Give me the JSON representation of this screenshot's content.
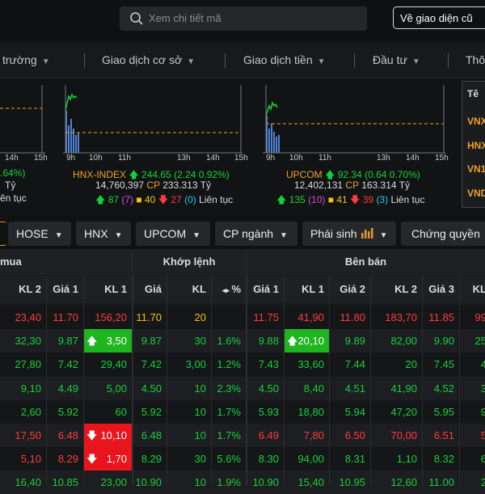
{
  "topbar": {
    "search_placeholder": "Xem chi tiết mã",
    "old_ui_label": "Về giao diện cũ"
  },
  "menu": [
    "ị trường",
    "Giao dịch cơ sở",
    "Giao dịch tiền",
    "Đầu tư",
    "Thô"
  ],
  "indices": [
    {
      "name": "",
      "value_text": ".64%)",
      "cp_text": "Tỷ",
      "status_text": "ên tục",
      "time_labels": [
        "14h",
        "15h"
      ]
    },
    {
      "name": "HNX-INDEX",
      "value": "244.65",
      "change": "(2.24 0.92%)",
      "volume": "14,760,397",
      "cp_label": "CP",
      "cp_value": "233.313",
      "unit": "Tỷ",
      "up": "87",
      "ref": "(7)",
      "flat": "40",
      "down": "27",
      "ceil": "(0)",
      "status": "Liên tục",
      "time_labels": [
        "9h",
        "10h",
        "11h",
        "13h",
        "14h",
        "15h"
      ]
    },
    {
      "name": "UPCOM",
      "value": "92.34",
      "change": "(0.64 0.70%)",
      "volume": "12,402,131",
      "cp_label": "CP",
      "cp_value": "163.314",
      "unit": "Tỷ",
      "up": "135",
      "ref": "(10)",
      "flat": "41",
      "down": "39",
      "ceil": "(3)",
      "status": "Liên tục",
      "time_labels": [
        "9h",
        "10h",
        "11h",
        "13h",
        "14h",
        "15h"
      ]
    }
  ],
  "right_panel": {
    "header": "Tê",
    "items": [
      "VNX",
      "HNX",
      "VN1",
      "VND"
    ]
  },
  "tabs": [
    "HOSE",
    "HNX",
    "UPCOM",
    "CP ngành",
    "Phái sinh",
    "Chứng quyền"
  ],
  "table": {
    "group_headers": {
      "buy": "mua",
      "match": "Khớp lệnh",
      "sell": "Bên bán"
    },
    "columns": [
      "KL 2",
      "Giá 1",
      "KL 1",
      "Giá",
      "KL",
      "%",
      "Giá 1",
      "KL 1",
      "Giá 2",
      "KL 2",
      "Giá 3",
      "KL"
    ],
    "rows": [
      [
        "23,40",
        "11.70",
        "156,20",
        "11.70",
        "20",
        "",
        "11.75",
        "41,90",
        "11.80",
        "183,70",
        "11.85",
        "99"
      ],
      [
        "32,30",
        "9.87",
        "3,50",
        "9.87",
        "30",
        "1.6%",
        "9.88",
        "20,10",
        "9.89",
        "82,00",
        "9.90",
        "25"
      ],
      [
        "27,80",
        "7.42",
        "29,40",
        "7.42",
        "3,00",
        "1.2%",
        "7.43",
        "33,60",
        "7.44",
        "20",
        "7.45",
        "4"
      ],
      [
        "9,10",
        "4.49",
        "5,00",
        "4.50",
        "10",
        "2.3%",
        "4.50",
        "8,40",
        "4.51",
        "41,90",
        "4.52",
        "3"
      ],
      [
        "2,60",
        "5.92",
        "60",
        "5.92",
        "10",
        "1.7%",
        "5.93",
        "18,80",
        "5.94",
        "47,20",
        "5.95",
        "9"
      ],
      [
        "17,50",
        "6.48",
        "10,10",
        "6.48",
        "10",
        "1.7%",
        "6.49",
        "7,80",
        "6.50",
        "70,00",
        "6.51",
        "5"
      ],
      [
        "5,10",
        "8.29",
        "1,70",
        "8.29",
        "30",
        "5.6%",
        "8.30",
        "94,00",
        "8.31",
        "1,10",
        "8.32",
        "6"
      ],
      [
        "16,40",
        "10.85",
        "23,00",
        "10.90",
        "10",
        "1.9%",
        "10.90",
        "15,40",
        "10.95",
        "12,60",
        "11.00",
        "2"
      ]
    ],
    "row_colors": [
      "#ff3b3b",
      "#16d03a",
      "#16d03a",
      "#16d03a",
      "#16d03a",
      "#ff3b3b",
      "#16d03a",
      "#16d03a"
    ],
    "row_first_color": [
      "#ff3b3b",
      "#16d03a",
      "#16d03a",
      "#16d03a",
      "#16d03a",
      "#ff3b3b",
      "#ff3b3b",
      "#16d03a"
    ],
    "match_price_color": [
      "#f2c20c",
      "#16d03a",
      "#16d03a",
      "#16d03a",
      "#16d03a",
      "#16d03a",
      "#16d03a",
      "#16d03a"
    ]
  },
  "colors": {
    "up": "#16d03a",
    "down": "#ff3b3b",
    "ref": "#f2c20c",
    "accent": "#e7932e"
  }
}
